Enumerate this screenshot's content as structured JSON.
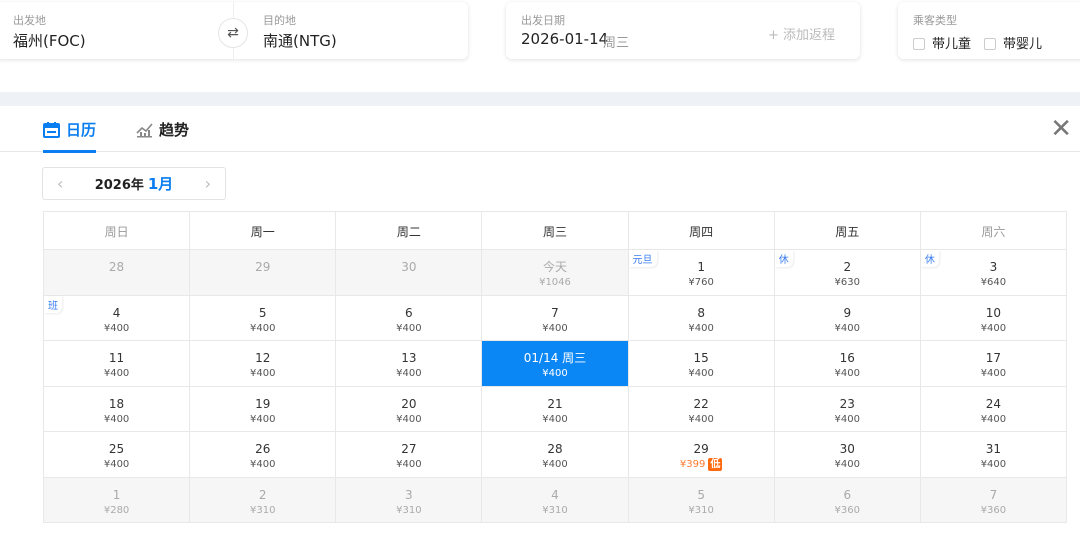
{
  "search": {
    "from_label": "出发地",
    "from_value": "福州(FOC)",
    "to_label": "目的地",
    "to_value": "南通(NTG)",
    "date_label": "出发日期",
    "date_value": "2026-01-14",
    "date_weekday": "周三",
    "return_label": "+ 添加返程",
    "passenger_label": "乘客类型",
    "child_label": "带儿童",
    "infant_label": "带婴儿"
  },
  "tabs": [
    {
      "label": "日历",
      "icon": "calendar-icon",
      "active": true
    },
    {
      "label": "趋势",
      "icon": "trend-chart-icon",
      "active": false
    }
  ],
  "month_nav": {
    "year": "2026年",
    "month": "1月"
  },
  "weekdays": [
    "周日",
    "周一",
    "周二",
    "周三",
    "周四",
    "周五",
    "周六"
  ],
  "weeks": [
    [
      {
        "d": "28",
        "p": "",
        "m": true
      },
      {
        "d": "29",
        "p": "",
        "m": true
      },
      {
        "d": "30",
        "p": "",
        "m": true
      },
      {
        "d": "今天",
        "p": "¥1046",
        "m": true
      },
      {
        "d": "1",
        "p": "¥760",
        "tag": "元旦"
      },
      {
        "d": "2",
        "p": "¥630",
        "tag": "休"
      },
      {
        "d": "3",
        "p": "¥640",
        "tag": "休"
      }
    ],
    [
      {
        "d": "4",
        "p": "¥400",
        "tag": "班"
      },
      {
        "d": "5",
        "p": "¥400"
      },
      {
        "d": "6",
        "p": "¥400"
      },
      {
        "d": "7",
        "p": "¥400"
      },
      {
        "d": "8",
        "p": "¥400"
      },
      {
        "d": "9",
        "p": "¥400"
      },
      {
        "d": "10",
        "p": "¥400"
      }
    ],
    [
      {
        "d": "11",
        "p": "¥400"
      },
      {
        "d": "12",
        "p": "¥400"
      },
      {
        "d": "13",
        "p": "¥400"
      },
      {
        "d": "01/14 周三",
        "p": "¥400",
        "sel": true
      },
      {
        "d": "15",
        "p": "¥400"
      },
      {
        "d": "16",
        "p": "¥400"
      },
      {
        "d": "17",
        "p": "¥400"
      }
    ],
    [
      {
        "d": "18",
        "p": "¥400"
      },
      {
        "d": "19",
        "p": "¥400"
      },
      {
        "d": "20",
        "p": "¥400"
      },
      {
        "d": "21",
        "p": "¥400"
      },
      {
        "d": "22",
        "p": "¥400"
      },
      {
        "d": "23",
        "p": "¥400"
      },
      {
        "d": "24",
        "p": "¥400"
      }
    ],
    [
      {
        "d": "25",
        "p": "¥400"
      },
      {
        "d": "26",
        "p": "¥400"
      },
      {
        "d": "27",
        "p": "¥400"
      },
      {
        "d": "28",
        "p": "¥400"
      },
      {
        "d": "29",
        "p": "¥399",
        "low": "低"
      },
      {
        "d": "30",
        "p": "¥400"
      },
      {
        "d": "31",
        "p": "¥400"
      }
    ],
    [
      {
        "d": "1",
        "p": "¥280",
        "m": true
      },
      {
        "d": "2",
        "p": "¥310",
        "m": true
      },
      {
        "d": "3",
        "p": "¥310",
        "m": true
      },
      {
        "d": "4",
        "p": "¥310",
        "m": true
      },
      {
        "d": "5",
        "p": "¥310",
        "m": true
      },
      {
        "d": "6",
        "p": "¥360",
        "m": true
      },
      {
        "d": "7",
        "p": "¥360",
        "m": true
      }
    ]
  ],
  "colors": {
    "accent": "#0a87f5",
    "low_price": "#ff7a2f",
    "holiday_tag": "#3a7cf0"
  }
}
